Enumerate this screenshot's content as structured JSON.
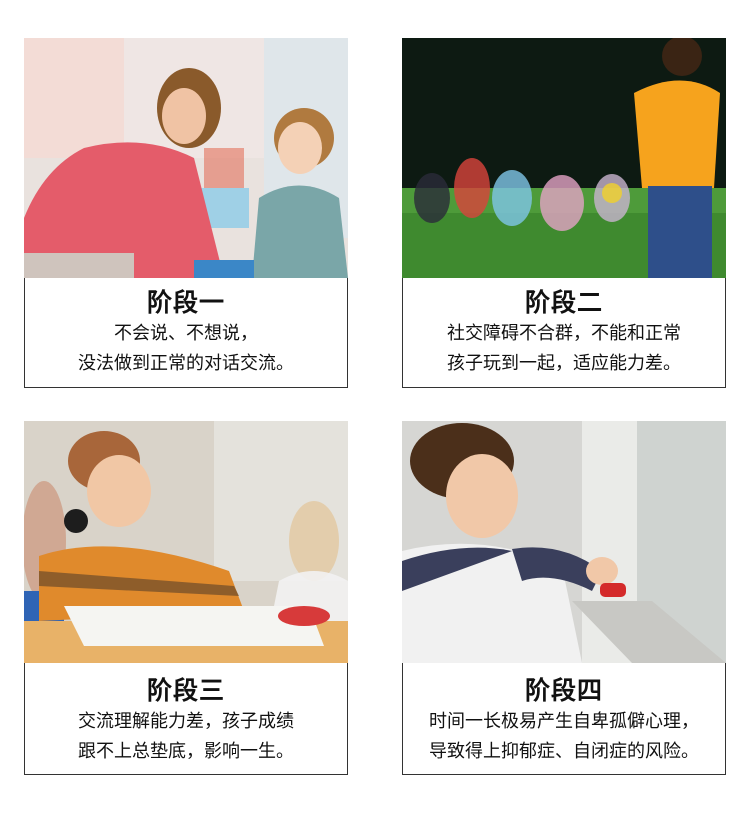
{
  "cards": [
    {
      "title": "阶段一",
      "lines": [
        "不会说、不想说，",
        "没法做到正常的对话交流。"
      ]
    },
    {
      "title": "阶段二",
      "lines": [
        "社交障碍不合群，不能和正常",
        "孩子玩到一起，适应能力差。"
      ]
    },
    {
      "title": "阶段三",
      "lines": [
        "交流理解能力差，孩子成绩",
        "跟不上总垫底，影响一生。"
      ]
    },
    {
      "title": "阶段四",
      "lines": [
        "时间一长极易产生自卑孤僻心理，",
        "导致得上抑郁症、自闭症的风险。"
      ]
    }
  ]
}
